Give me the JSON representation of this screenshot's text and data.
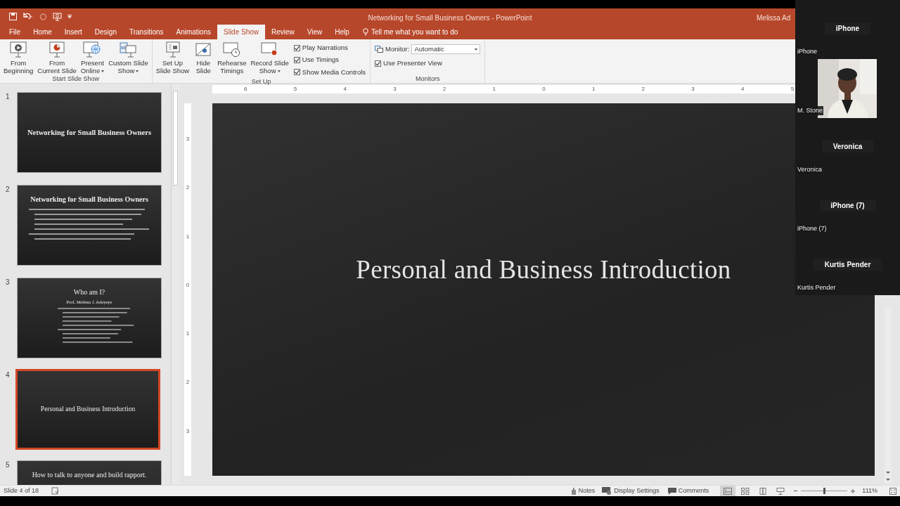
{
  "window": {
    "title": "Networking for Small Business Owners  -  PowerPoint",
    "user": "Melissa Ad"
  },
  "tabs": [
    {
      "label": "File",
      "selected": false
    },
    {
      "label": "Home",
      "selected": false
    },
    {
      "label": "Insert",
      "selected": false
    },
    {
      "label": "Design",
      "selected": false
    },
    {
      "label": "Transitions",
      "selected": false
    },
    {
      "label": "Animations",
      "selected": false
    },
    {
      "label": "Slide Show",
      "selected": true
    },
    {
      "label": "Review",
      "selected": false
    },
    {
      "label": "View",
      "selected": false
    },
    {
      "label": "Help",
      "selected": false
    }
  ],
  "tell_me": "Tell me what you want to do",
  "ribbon_groups": [
    {
      "label": "Start Slide Show",
      "items": [
        {
          "kind": "button",
          "lines": [
            "From",
            "Beginning"
          ],
          "dropdown": false
        },
        {
          "kind": "button",
          "lines": [
            "From",
            "Current Slide"
          ],
          "dropdown": false
        },
        {
          "kind": "button",
          "lines": [
            "Present",
            "Online"
          ],
          "dropdown": true
        },
        {
          "kind": "button",
          "lines": [
            "Custom Slide",
            "Show"
          ],
          "dropdown": true
        }
      ]
    },
    {
      "label": "Set Up",
      "items": [
        {
          "kind": "button",
          "lines": [
            "Set Up",
            "Slide Show"
          ],
          "dropdown": false
        },
        {
          "kind": "button",
          "lines": [
            "Hide",
            "Slide"
          ],
          "dropdown": false
        },
        {
          "kind": "button",
          "lines": [
            "Rehearse",
            "Timings"
          ],
          "dropdown": false
        },
        {
          "kind": "button",
          "lines": [
            "Record Slide",
            "Show"
          ],
          "dropdown": true
        },
        {
          "kind": "checks",
          "checks": [
            {
              "label": "Play Narrations",
              "checked": true
            },
            {
              "label": "Use Timings",
              "checked": true
            },
            {
              "label": "Show Media Controls",
              "checked": true
            }
          ]
        }
      ]
    },
    {
      "label": "Monitors",
      "items": [
        {
          "kind": "monitor",
          "label": "Monitor:",
          "value": "Automatic",
          "checks": [
            {
              "label": "Use Presenter View",
              "checked": true
            }
          ]
        }
      ]
    }
  ],
  "h_ruler": [
    "6",
    "5",
    "4",
    "3",
    "2",
    "1",
    "0",
    "1",
    "2",
    "3",
    "4",
    "5"
  ],
  "v_ruler": [
    "3",
    "2",
    "1",
    "0",
    "1",
    "2",
    "3"
  ],
  "slides": [
    {
      "number": "1",
      "kind": "title",
      "title": "Networking for Small Business Owners",
      "selected": false
    },
    {
      "number": "2",
      "kind": "content",
      "title": "Networking for Small Business Owners",
      "selected": false
    },
    {
      "number": "3",
      "kind": "bio",
      "title": "Who am I?",
      "subtitle": "Prof. Melissa J. Adeyeye",
      "selected": false
    },
    {
      "number": "4",
      "kind": "section",
      "title": "Personal and Business Introduction",
      "selected": true
    },
    {
      "number": "5",
      "kind": "heading",
      "title": "How to talk to anyone and build rapport.",
      "selected": false
    }
  ],
  "main_slide": {
    "title": "Personal and Business Introduction"
  },
  "status": {
    "slide": "Slide 4 of 18",
    "notes": "Notes",
    "display": "Display Settings",
    "comments": "Comments",
    "views": [
      {
        "selected": true
      },
      {
        "selected": false
      },
      {
        "selected": false
      },
      {
        "selected": false
      }
    ],
    "zoom": {
      "level": 0.5,
      "reading": "111%"
    }
  },
  "participants": [
    {
      "kind": "avatar",
      "title": "iPhone",
      "name": "iPhone"
    },
    {
      "kind": "video",
      "name": "M. Stone"
    },
    {
      "kind": "avatar",
      "title": "Veronica",
      "name": "Veronica"
    },
    {
      "kind": "avatar",
      "title": "iPhone (7)",
      "name": "iPhone (7)"
    },
    {
      "kind": "avatar",
      "title": "Kurtis Pender",
      "name": "Kurtis Pender"
    }
  ]
}
